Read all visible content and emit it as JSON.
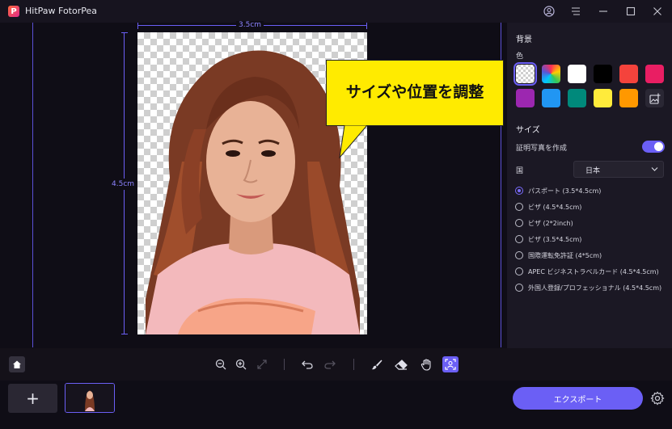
{
  "app": {
    "title": "HitPaw FotorPea",
    "logo_letter": "P"
  },
  "canvas": {
    "width_label": "3.5cm",
    "height_label": "4.5cm",
    "callout_text": "サイズや位置を調整"
  },
  "panel": {
    "background_title": "背景",
    "color_label": "色",
    "colors": [
      "transparent",
      "rainbow",
      "#ffffff",
      "#000000",
      "#f4433c",
      "#e91e63",
      "#9c27b0",
      "#2196f3",
      "#00897b",
      "#ffeb3b",
      "#ff9800",
      "picker"
    ],
    "size_title": "サイズ",
    "id_photo_label": "証明写真を作成",
    "id_photo_enabled": true,
    "country_label": "国",
    "country_value": "日本",
    "size_options": [
      {
        "label": "パスポート (3.5*4.5cm)",
        "selected": true
      },
      {
        "label": "ビザ (4.5*4.5cm)",
        "selected": false
      },
      {
        "label": "ビザ (2*2inch)",
        "selected": false
      },
      {
        "label": "ビザ (3.5*4.5cm)",
        "selected": false
      },
      {
        "label": "国際運転免許証 (4*5cm)",
        "selected": false
      },
      {
        "label": "APEC ビジネストラベルカード (4.5*4.5cm)",
        "selected": false
      },
      {
        "label": "外国人登録/プロフェッショナル (4.5*4.5cm)",
        "selected": false
      }
    ]
  },
  "toolbar": {
    "tools": [
      "zoom-out",
      "zoom-in",
      "fit",
      "undo",
      "redo",
      "brush",
      "eraser",
      "hand",
      "face-adjust"
    ]
  },
  "bottom": {
    "add_label": "+",
    "export_label": "エクスポート"
  },
  "theme": {
    "accent": "#6b5ff5",
    "callout": "#ffeb00"
  }
}
